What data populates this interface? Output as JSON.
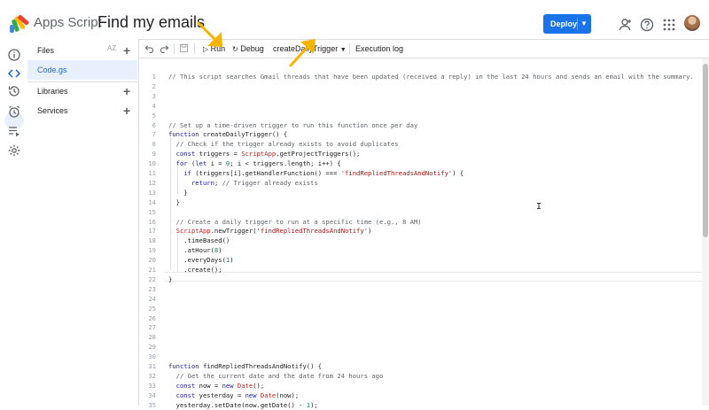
{
  "app": {
    "name": "Apps Script",
    "project_title": "Find my emails",
    "deploy_label": "Deploy"
  },
  "files_panel": {
    "header": "Files",
    "sort_icon": "AZ",
    "file_name": "Code.gs",
    "libraries_label": "Libraries",
    "services_label": "Services"
  },
  "toolbar": {
    "run_label": "Run",
    "debug_label": "Debug",
    "function_select": "createDailyTrigger",
    "execution_log_label": "Execution log"
  },
  "code": [
    {
      "n": "1",
      "t": "// This script searches Gmail threads that have been updated (received a reply) in the last 24 hours and sends an email with the summary."
    },
    {
      "n": "2",
      "t": ""
    },
    {
      "n": "3",
      "t": ""
    },
    {
      "n": "4",
      "t": ""
    },
    {
      "n": "5",
      "t": ""
    },
    {
      "n": "6",
      "t": "// Set up a time-driven trigger to run this function once per day"
    },
    {
      "n": "7",
      "t": "function createDailyTrigger() {"
    },
    {
      "n": "8",
      "t": "  // Check if the trigger already exists to avoid duplicates"
    },
    {
      "n": "9",
      "t": "  const triggers = ScriptApp.getProjectTriggers();"
    },
    {
      "n": "10",
      "t": "  for (let i = 0; i < triggers.length; i++) {"
    },
    {
      "n": "11",
      "t": "    if (triggers[i].getHandlerFunction() === 'findRepliedThreadsAndNotify') {"
    },
    {
      "n": "12",
      "t": "      return; // Trigger already exists"
    },
    {
      "n": "13",
      "t": "    }"
    },
    {
      "n": "14",
      "t": "  }"
    },
    {
      "n": "15",
      "t": ""
    },
    {
      "n": "16",
      "t": "  // Create a daily trigger to run at a specific time (e.g., 8 AM)"
    },
    {
      "n": "17",
      "t": "  ScriptApp.newTrigger('findRepliedThreadsAndNotify')"
    },
    {
      "n": "18",
      "t": "    .timeBased()"
    },
    {
      "n": "19",
      "t": "    .atHour(8)"
    },
    {
      "n": "20",
      "t": "    .everyDays(1)"
    },
    {
      "n": "21",
      "t": "    .create();"
    },
    {
      "n": "22",
      "t": "}"
    },
    {
      "n": "23",
      "t": ""
    },
    {
      "n": "24",
      "t": ""
    },
    {
      "n": "25",
      "t": ""
    },
    {
      "n": "26",
      "t": ""
    },
    {
      "n": "27",
      "t": ""
    },
    {
      "n": "28",
      "t": ""
    },
    {
      "n": "29",
      "t": ""
    },
    {
      "n": "30",
      "t": ""
    },
    {
      "n": "31",
      "t": "function findRepliedThreadsAndNotify() {"
    },
    {
      "n": "32",
      "t": "  // Get the current date and the date from 24 hours ago"
    },
    {
      "n": "33",
      "t": "  const now = new Date();"
    },
    {
      "n": "34",
      "t": "  const yesterday = new Date(now);"
    },
    {
      "n": "35",
      "t": "  yesterday.setDate(now.getDate() - 1);"
    }
  ],
  "colors": {
    "accent": "#1a73e8",
    "keyword": "#1a1aa6",
    "string": "#a31515",
    "comment": "#5f6368",
    "annotation_arrow": "#f4b400"
  }
}
